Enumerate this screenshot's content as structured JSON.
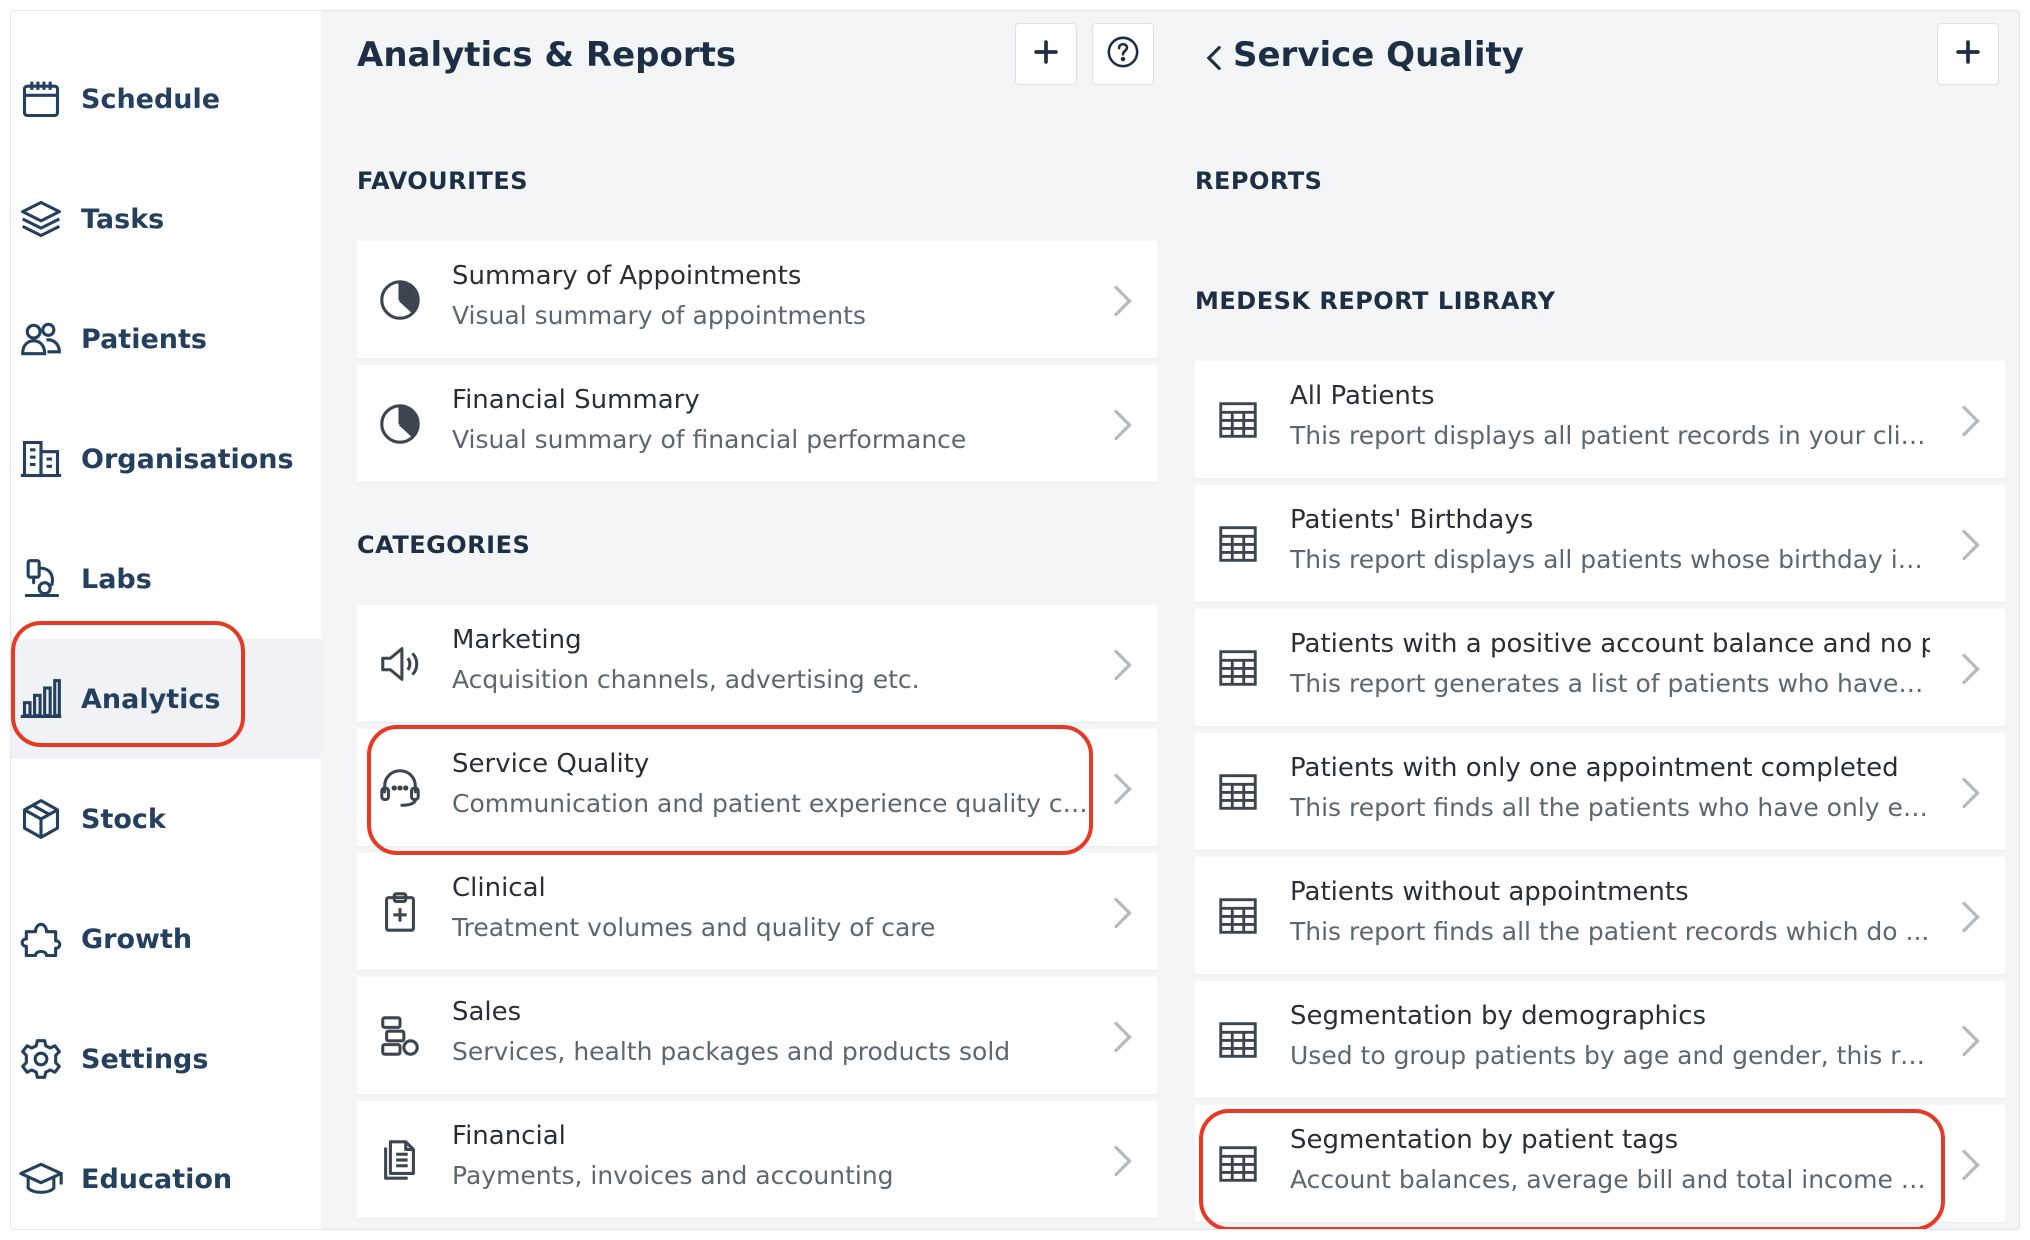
{
  "sidebar": {
    "items": [
      {
        "label": "Schedule",
        "icon": "calendar-icon"
      },
      {
        "label": "Tasks",
        "icon": "layers-icon"
      },
      {
        "label": "Patients",
        "icon": "users-icon"
      },
      {
        "label": "Organisations",
        "icon": "building-icon"
      },
      {
        "label": "Labs",
        "icon": "microscope-icon"
      },
      {
        "label": "Analytics",
        "icon": "bar-chart-icon",
        "active": true
      },
      {
        "label": "Stock",
        "icon": "box-icon"
      },
      {
        "label": "Growth",
        "icon": "puzzle-icon"
      },
      {
        "label": "Settings",
        "icon": "gear-icon"
      },
      {
        "label": "Education",
        "icon": "graduation-cap-icon"
      }
    ]
  },
  "analytics": {
    "title": "Analytics & Reports",
    "favourites_label": "FAVOURITES",
    "categories_label": "CATEGORIES",
    "favourites": [
      {
        "title": "Summary of Appointments",
        "subtitle": "Visual summary of appointments",
        "icon": "pie-chart-icon"
      },
      {
        "title": "Financial Summary",
        "subtitle": "Visual summary of financial performance",
        "icon": "pie-chart-icon"
      }
    ],
    "categories": [
      {
        "title": "Marketing",
        "subtitle": "Acquisition channels, advertising etc.",
        "icon": "megaphone-icon"
      },
      {
        "title": "Service Quality",
        "subtitle": "Communication and patient experience quality co...",
        "icon": "headset-icon"
      },
      {
        "title": "Clinical",
        "subtitle": "Treatment volumes and quality of care",
        "icon": "clipboard-icon"
      },
      {
        "title": "Sales",
        "subtitle": "Services, health packages and products sold",
        "icon": "products-icon"
      },
      {
        "title": "Financial",
        "subtitle": "Payments, invoices and accounting",
        "icon": "document-icon"
      }
    ]
  },
  "service_quality": {
    "title": "Service Quality",
    "reports_label": "REPORTS",
    "library_label": "MEDESK REPORT LIBRARY",
    "reports": [
      {
        "title": "All Patients",
        "subtitle": "This report displays all patient records in your clinic."
      },
      {
        "title": "Patients' Birthdays",
        "subtitle": "This report displays all patients whose birthday is ..."
      },
      {
        "title": "Patients with a positive account balance and no pl...",
        "subtitle": "This report generates a list of patients who have a..."
      },
      {
        "title": "Patients with only one appointment completed",
        "subtitle": "This report finds all the patients who have only ev..."
      },
      {
        "title": "Patients without appointments",
        "subtitle": "This report finds all the patient records which do ..."
      },
      {
        "title": "Segmentation by demographics",
        "subtitle": "Used to group patients by age and gender, this re..."
      },
      {
        "title": "Segmentation by patient tags",
        "subtitle": "Account balances, average bill and total income b..."
      }
    ]
  },
  "colors": {
    "nav_text": "#24405f",
    "heading": "#1d2f45",
    "highlight": "#e63a24",
    "background": "#f4f5f7"
  }
}
